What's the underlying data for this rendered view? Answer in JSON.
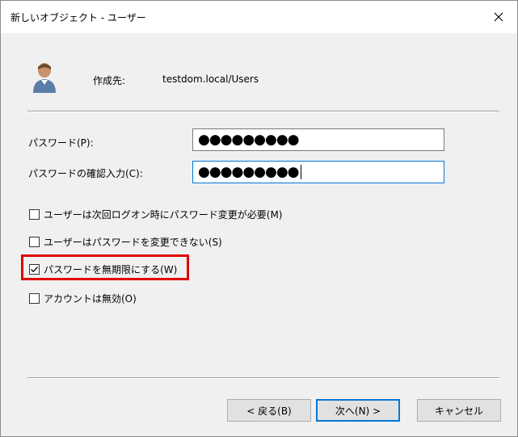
{
  "window": {
    "title": "新しいオブジェクト - ユーザー"
  },
  "header": {
    "created_in_label": "作成先:",
    "created_in_value": "testdom.local/Users",
    "icon": "user-icon"
  },
  "fields": {
    "password_label": "パスワード(P):",
    "password_value": "●●●●●●●●●",
    "confirm_label": "パスワードの確認入力(C):",
    "confirm_value": "●●●●●●●●●"
  },
  "checkboxes": [
    {
      "label": "ユーザーは次回ログオン時にパスワード変更が必要(M)",
      "checked": false
    },
    {
      "label": "ユーザーはパスワードを変更できない(S)",
      "checked": false
    },
    {
      "label": "パスワードを無期限にする(W)",
      "checked": true
    },
    {
      "label": "アカウントは無効(O)",
      "checked": false
    }
  ],
  "buttons": {
    "back": "< 戻る(B)",
    "next": "次へ(N) >",
    "cancel": "キャンセル"
  },
  "colors": {
    "highlight": "#e10000",
    "focus": "#0078d7"
  }
}
